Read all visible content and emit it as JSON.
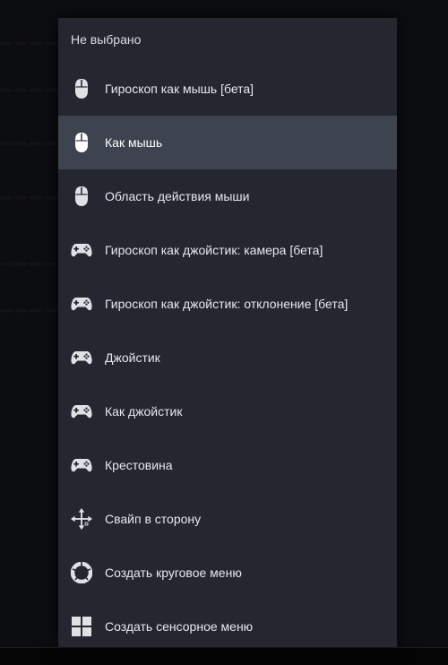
{
  "menu": {
    "header": "Не выбрано",
    "items": [
      {
        "label": "Гироскоп как мышь [бета]",
        "icon": "mouse-icon",
        "selected": false
      },
      {
        "label": "Как мышь",
        "icon": "mouse-icon",
        "selected": true
      },
      {
        "label": "Область действия мыши",
        "icon": "mouse-icon",
        "selected": false
      },
      {
        "label": "Гироскоп как джойстик: камера [бета]",
        "icon": "gamepad-icon",
        "selected": false
      },
      {
        "label": "Гироскоп как джойстик: отклонение [бета]",
        "icon": "gamepad-icon",
        "selected": false
      },
      {
        "label": "Джойстик",
        "icon": "gamepad-icon",
        "selected": false
      },
      {
        "label": "Как джойстик",
        "icon": "gamepad-icon",
        "selected": false
      },
      {
        "label": "Крестовина",
        "icon": "gamepad-icon",
        "selected": false
      },
      {
        "label": "Свайп в сторону",
        "icon": "swipe-arrows-icon",
        "selected": false
      },
      {
        "label": "Создать круговое меню",
        "icon": "radial-menu-icon",
        "selected": false
      },
      {
        "label": "Создать сенсорное меню",
        "icon": "grid-menu-icon",
        "selected": false
      }
    ]
  },
  "colors": {
    "menu_bg": "#24272f",
    "selected_bg": "#3d4450",
    "text": "#e6e8ec",
    "icon": "#dfe1e5"
  }
}
